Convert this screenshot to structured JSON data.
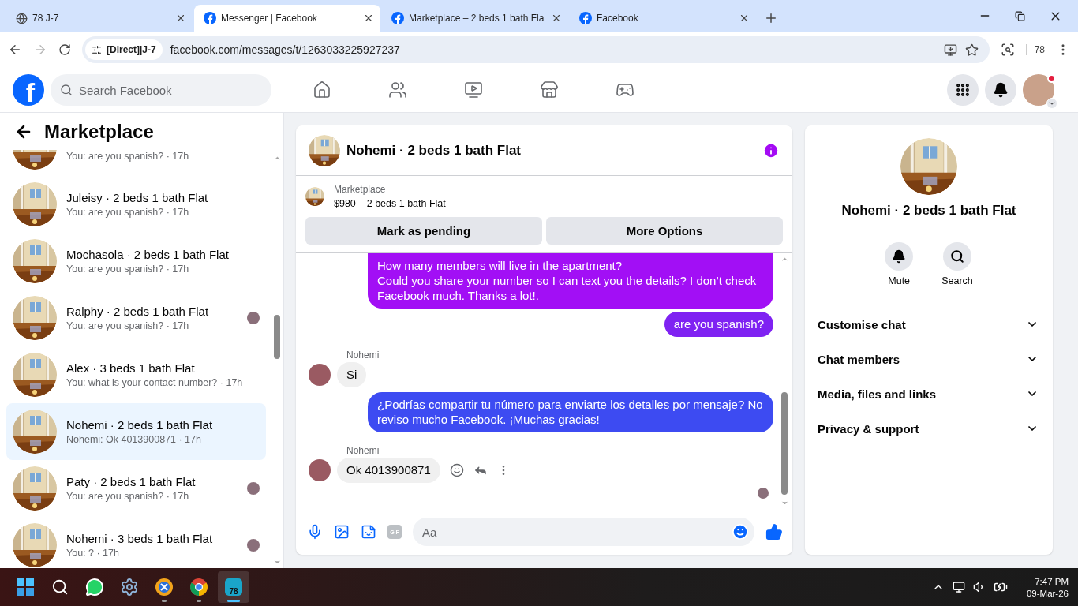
{
  "browser": {
    "tabs": [
      {
        "title": "78 J-7",
        "kind": "globe",
        "selected": false
      },
      {
        "title": "Messenger | Facebook",
        "kind": "facebook",
        "selected": true
      },
      {
        "title": "Marketplace – 2 beds 1 bath Fla",
        "kind": "facebook",
        "selected": false
      },
      {
        "title": "Facebook",
        "kind": "facebook",
        "selected": false
      }
    ],
    "site_chip": "[Direct]|J-7",
    "url": "facebook.com/messages/t/1263033225927237",
    "profile": "78",
    "forward_disabled": true
  },
  "fb_header": {
    "logo": "f",
    "search": {
      "placeholder": "Search Facebook"
    },
    "notification_dot": true
  },
  "sidebar": {
    "title": "Marketplace",
    "conversations": [
      {
        "preview": "You: are you spanish? · 17h",
        "selected": false,
        "seen": false
      },
      {
        "name": "Juleisy · 2 beds 1 bath Flat",
        "preview": "You: are you spanish? · 17h",
        "selected": false,
        "seen": false
      },
      {
        "name": "Mochasola · 2 beds 1 bath Flat",
        "preview": "You: are you spanish? · 17h",
        "selected": false,
        "seen": false
      },
      {
        "name": "Ralphy · 2 beds 1 bath Flat",
        "preview": "You: are you spanish? · 17h",
        "selected": false,
        "seen": true
      },
      {
        "name": "Alex · 3 beds 1 bath Flat",
        "preview": "You: what is your contact number? · 17h",
        "selected": false,
        "seen": false
      },
      {
        "name": "Nohemi · 2 beds 1 bath Flat",
        "preview": "Nohemi: Ok 4013900871 · 17h",
        "selected": true,
        "seen": false
      },
      {
        "name": "Paty · 2 beds 1 bath Flat",
        "preview": "You: are you spanish? · 17h",
        "selected": false,
        "seen": true
      },
      {
        "name": "Nohemi · 3 beds 1 bath Flat",
        "preview": "You: ? · 17h",
        "selected": false,
        "seen": true
      }
    ]
  },
  "chat": {
    "title": "Nohemi · 2 beds 1 bath Flat",
    "listing": {
      "source": "Marketplace",
      "title": "$980 – 2 beds 1 bath Flat"
    },
    "buttons": [
      "Mark as pending",
      "More Options"
    ],
    "messages": [
      {
        "kind": "sent",
        "text": "How many members will live in the apartment?\nCould you share your number so I can text you the details? I don’t check Facebook much. Thanks a lot!.",
        "color": "#a20ff5"
      },
      {
        "kind": "sent",
        "text": "are you spanish?",
        "color": "#7f22f2"
      },
      {
        "kind": "sender",
        "text": "Nohemi"
      },
      {
        "kind": "received",
        "text": "Si",
        "hovered": false
      },
      {
        "kind": "sent",
        "text": "¿Podrías compartir tu número para enviarte los detalles por mensaje? No reviso mucho Facebook. ¡Muchas gracias!",
        "color": "#3d4bf2"
      },
      {
        "kind": "sender",
        "text": "Nohemi"
      },
      {
        "kind": "received",
        "text": "Ok  4013900871",
        "hovered": true
      }
    ],
    "composer": {
      "gif": "GIF",
      "placeholder": "Aa"
    }
  },
  "details": {
    "title": "Nohemi · 2 beds 1 bath Flat",
    "actions": [
      {
        "label": "Mute",
        "kind": "bell"
      },
      {
        "label": "Search",
        "kind": "search"
      }
    ],
    "sections": [
      {
        "label": "Customise chat",
        "expanded": false
      },
      {
        "label": "Chat members",
        "expanded": false
      },
      {
        "label": "Media, files and links",
        "expanded": false
      },
      {
        "label": "Privacy & support",
        "expanded": false
      }
    ]
  },
  "taskbar": {
    "apps": [
      {
        "kind": "start",
        "running": false,
        "selected": false
      },
      {
        "kind": "search",
        "running": false,
        "selected": false
      },
      {
        "kind": "whatsapp",
        "running": false,
        "selected": false
      },
      {
        "kind": "settings",
        "running": false,
        "selected": false
      },
      {
        "kind": "app",
        "running": true,
        "selected": false
      },
      {
        "kind": "chrome",
        "running": true,
        "selected": false
      },
      {
        "kind": "badge",
        "label": "78",
        "running": true,
        "selected": true
      }
    ],
    "time": "7:47 PM",
    "date": "09-Mar-26"
  }
}
